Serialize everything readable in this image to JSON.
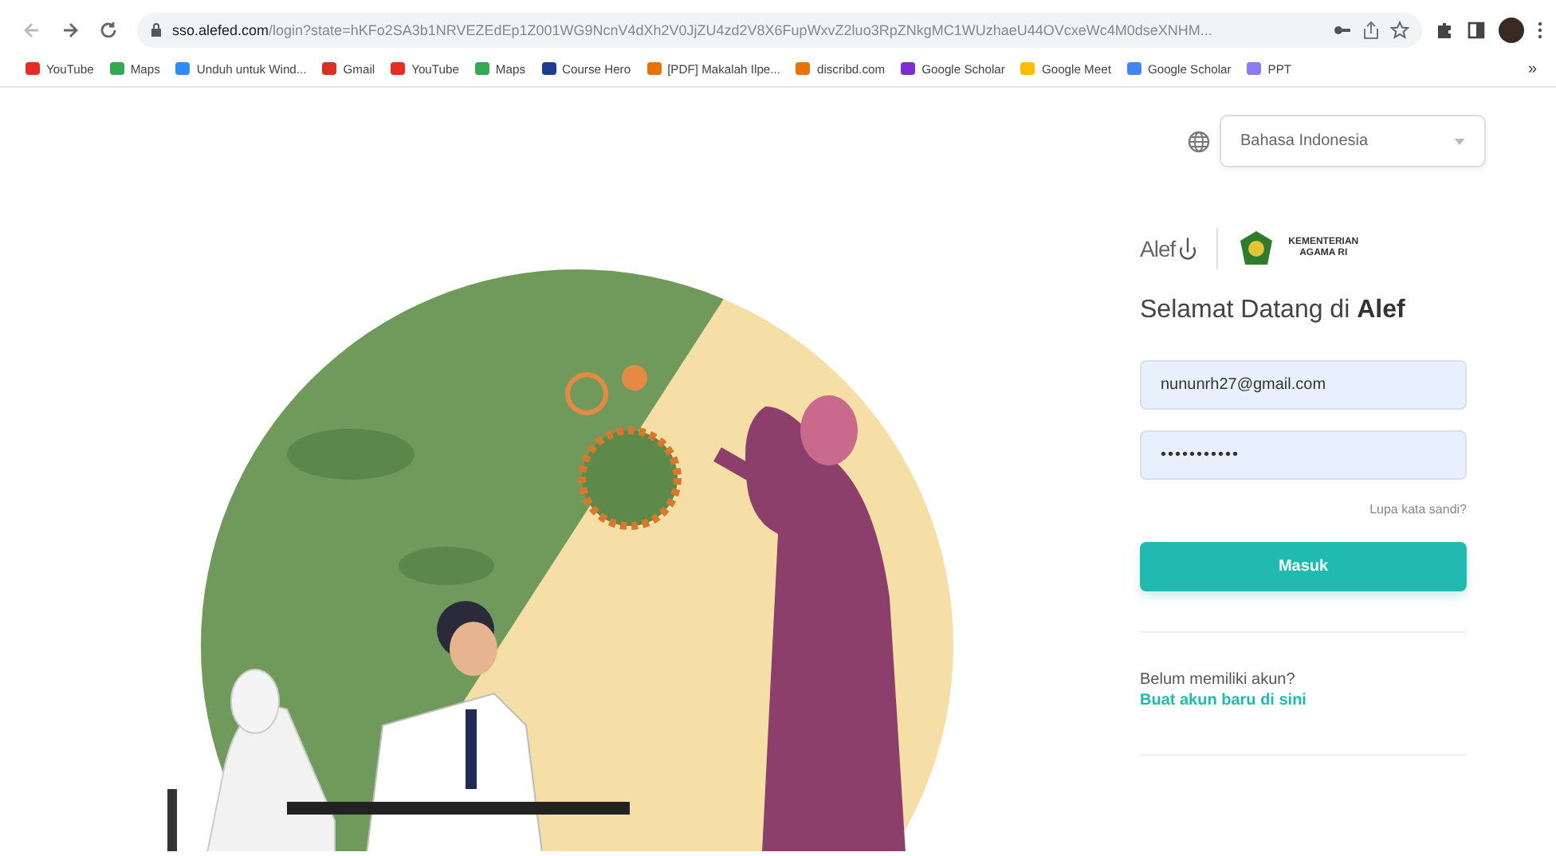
{
  "browser": {
    "url_host": "sso.alefed.com",
    "url_path": "/login?state=hKFo2SA3b1NRVEZEdEp1Z001WG9NcnV4dXh2V0JjZU4zd2V8X6FupWxvZ2luo3RpZNkgMC1WUzhaeU44OVcxeWc4M0dseXNHM...",
    "overflow": "»"
  },
  "bookmarks": [
    {
      "label": "YouTube",
      "color": "#e52d27"
    },
    {
      "label": "Maps",
      "color": "#34a853"
    },
    {
      "label": "Unduh untuk Wind...",
      "color": "#2d8cff"
    },
    {
      "label": "Gmail",
      "color": "#d93025"
    },
    {
      "label": "YouTube",
      "color": "#e52d27"
    },
    {
      "label": "Maps",
      "color": "#34a853"
    },
    {
      "label": "Course Hero",
      "color": "#1c3d8f"
    },
    {
      "label": "[PDF] Makalah Ilpe...",
      "color": "#e8710a"
    },
    {
      "label": "discribd.com",
      "color": "#e8710a"
    },
    {
      "label": "Google Scholar",
      "color": "#7b2fd0"
    },
    {
      "label": "Google Meet",
      "color": "#fbbc04"
    },
    {
      "label": "Google Scholar",
      "color": "#4285f4"
    },
    {
      "label": "PPT",
      "color": "#8a7cf0"
    }
  ],
  "page": {
    "language": "Bahasa Indonesia",
    "logo_text": "Alef",
    "partner_text": [
      "KEMENTERIAN",
      "AGAMA RI"
    ],
    "heading": "Selamat Datang di **Alef**",
    "email": "nununrh27@gmail.com",
    "password": "•••••••••••",
    "forgot": "Lupa kata sandi?",
    "login": "Masuk",
    "signup_prompt": "Belum memiliki akun?",
    "signup_link": "Buat akun baru di sini"
  }
}
